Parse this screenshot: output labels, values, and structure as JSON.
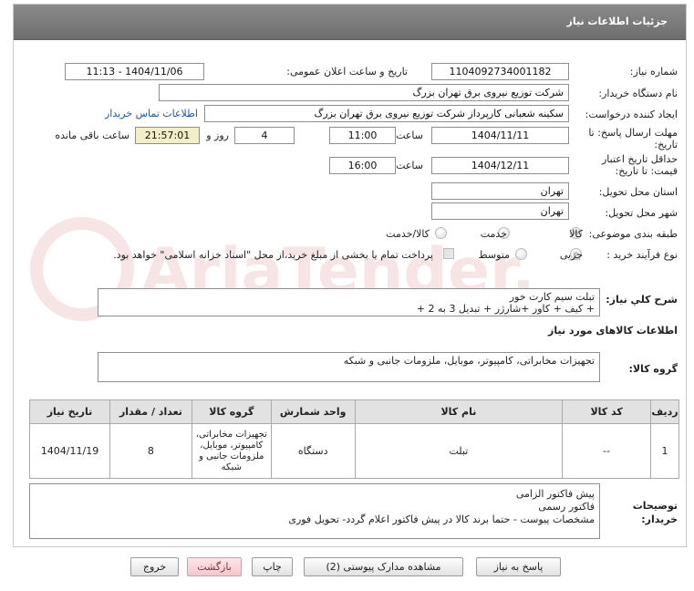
{
  "panel": {
    "title": "جزئیات اطلاعات نیاز"
  },
  "need_number": {
    "label": "شماره نیاز:",
    "value": "1104092734001182"
  },
  "announce": {
    "label": "تاریخ و ساعت اعلان عمومی:",
    "value": "1404/11/06 - 11:13"
  },
  "buyer": {
    "label": "نام دستگاه خریدار:",
    "value": "شرکت توزیع نیروی برق تهران بزرگ"
  },
  "creator": {
    "label": "ایجاد کننده درخواست:",
    "value": "سکینه شعبانی کارپرداز شرکت توزیع نیروی برق تهران بزرگ",
    "contact_link": "اطلاعات تماس خریدار"
  },
  "deadline": {
    "label_line1": "مهلت ارسال پاسخ: تا",
    "label_line2": "تاریخ:",
    "date": "1404/11/11",
    "time_label": "ساعت",
    "time": "11:00",
    "days": "4",
    "days_label": "روز و",
    "remaining": "21:57:01",
    "remaining_label": "ساعت باقی مانده"
  },
  "validity": {
    "label_line1": "حداقل تاریخ اعتبار",
    "label_line2": "قیمت: تا تاریخ:",
    "date": "1404/12/11",
    "time_label": "ساعت",
    "time": "16:00"
  },
  "province": {
    "label": "استان محل تحویل:",
    "value": "تهران"
  },
  "city": {
    "label": "شهر محل تحویل:",
    "value": "تهران"
  },
  "category": {
    "label": "طبقه بندی موضوعی:",
    "options": [
      "کالا",
      "خدمت",
      "کالا/خدمت"
    ],
    "selected": "کالا"
  },
  "process": {
    "label": "نوع فرآیند خرید :",
    "options": [
      "جزیی",
      "متوسط"
    ],
    "selected": "جزیی",
    "payment_note": "پرداخت تمام یا بخشی از مبلغ خرید،از محل \"اسناد خزانه اسلامی\" خواهد بود."
  },
  "summary": {
    "label": "شرح کلي نياز:",
    "value": "تبلت سیم کارت خور\n+ کیف + کاور +شارژر + تبدیل 3 به 2 +"
  },
  "items_section": {
    "title": "اطلاعات کالاهای مورد نیاز"
  },
  "goods_group": {
    "label": "گروه کالا:",
    "value": "تجهیزات مخابراتی، کامپیوتر، موبایل، ملزومات جانبی و شبکه"
  },
  "table": {
    "headers": [
      "ردیف",
      "کد کالا",
      "نام کالا",
      "واحد شمارش",
      "گروه کالا",
      "تعداد / مقدار",
      "تاریخ نیاز"
    ],
    "rows": [
      {
        "row": "1",
        "code": "--",
        "name": "تبلت",
        "unit": "دستگاه",
        "group": "تجهیزات مخابراتی، کامپیوتر، موبایل، ملزومات جانبی و شبکه",
        "qty": "8",
        "date": "1404/11/19"
      }
    ]
  },
  "notes": {
    "label_line1": "توضیحات",
    "label_line2": "خریدار:",
    "value": "پیش فاکتور الزامی\nفاکتور رسمی\nمشخصات پیوست - حتما برند کالا در پیش فاکتور اعلام گردد- تحویل فوری"
  },
  "buttons": {
    "reply": "پاسخ به نیاز",
    "attachments": "مشاهده مدارک پیوستی (2)",
    "print": "چاپ",
    "back": "بازگشت",
    "exit": "خروج"
  },
  "watermark": "AriaTender.net"
}
